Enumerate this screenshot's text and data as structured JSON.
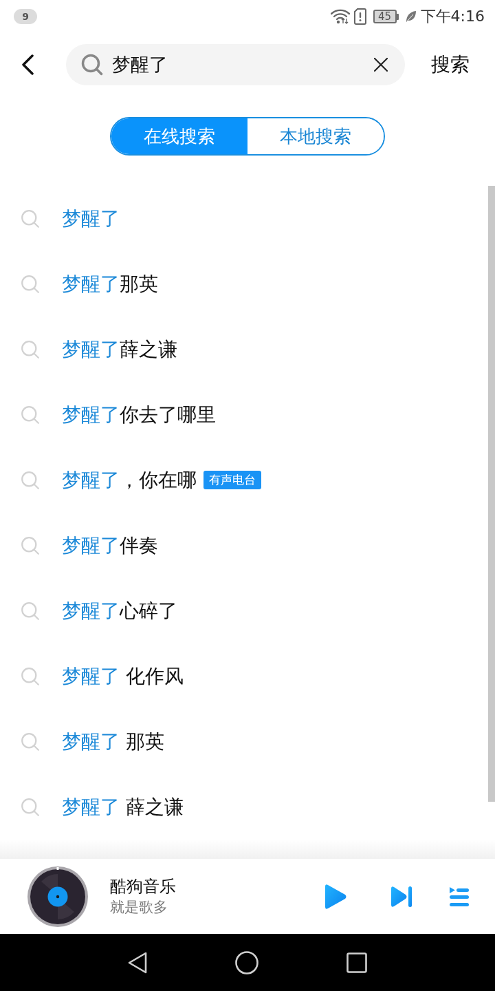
{
  "status_bar": {
    "notification_count": "9",
    "battery": "45",
    "time": "下午4:16"
  },
  "search": {
    "value": "梦醒了",
    "action": "搜索"
  },
  "tabs": [
    {
      "label": "在线搜索",
      "selected": true
    },
    {
      "label": "本地搜索",
      "selected": false
    }
  ],
  "suggestions": [
    {
      "match": "梦醒了"
    },
    {
      "match": "梦醒了",
      "rest": "那英"
    },
    {
      "match": "梦醒了",
      "rest": "薛之谦"
    },
    {
      "match": "梦醒了",
      "rest": "你去了哪里"
    },
    {
      "match": "梦醒了",
      "rest": "，你在哪",
      "badge": "有声电台"
    },
    {
      "match": "梦醒了",
      "rest": "伴奏"
    },
    {
      "match": "梦醒了",
      "rest": "心碎了"
    },
    {
      "match": "梦醒了",
      "rest": " 化作风"
    },
    {
      "match": "梦醒了",
      "rest": " 那英"
    },
    {
      "match": "梦醒了",
      "rest": " 薛之谦"
    }
  ],
  "player": {
    "title": "酷狗音乐",
    "subtitle": "就是歌多"
  }
}
